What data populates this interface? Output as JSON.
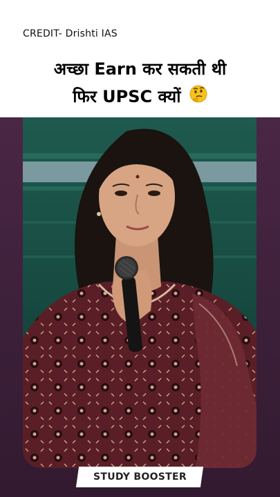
{
  "header": {
    "credit": "CREDIT- Drishti IAS",
    "headline_line1": "अच्छा Earn कर सकती थी",
    "headline_line2": "फिर UPSC क्यों",
    "emoji": "thinking-face-icon"
  },
  "video": {
    "subject": "woman-speaking-with-microphone"
  },
  "badge": {
    "label": "STUDY BOOSTER"
  },
  "colors": {
    "panel_background": "#4a2745",
    "video_backdrop": "#163a34",
    "kurta": "#5a1e26",
    "badge_background": "#ffffff"
  }
}
